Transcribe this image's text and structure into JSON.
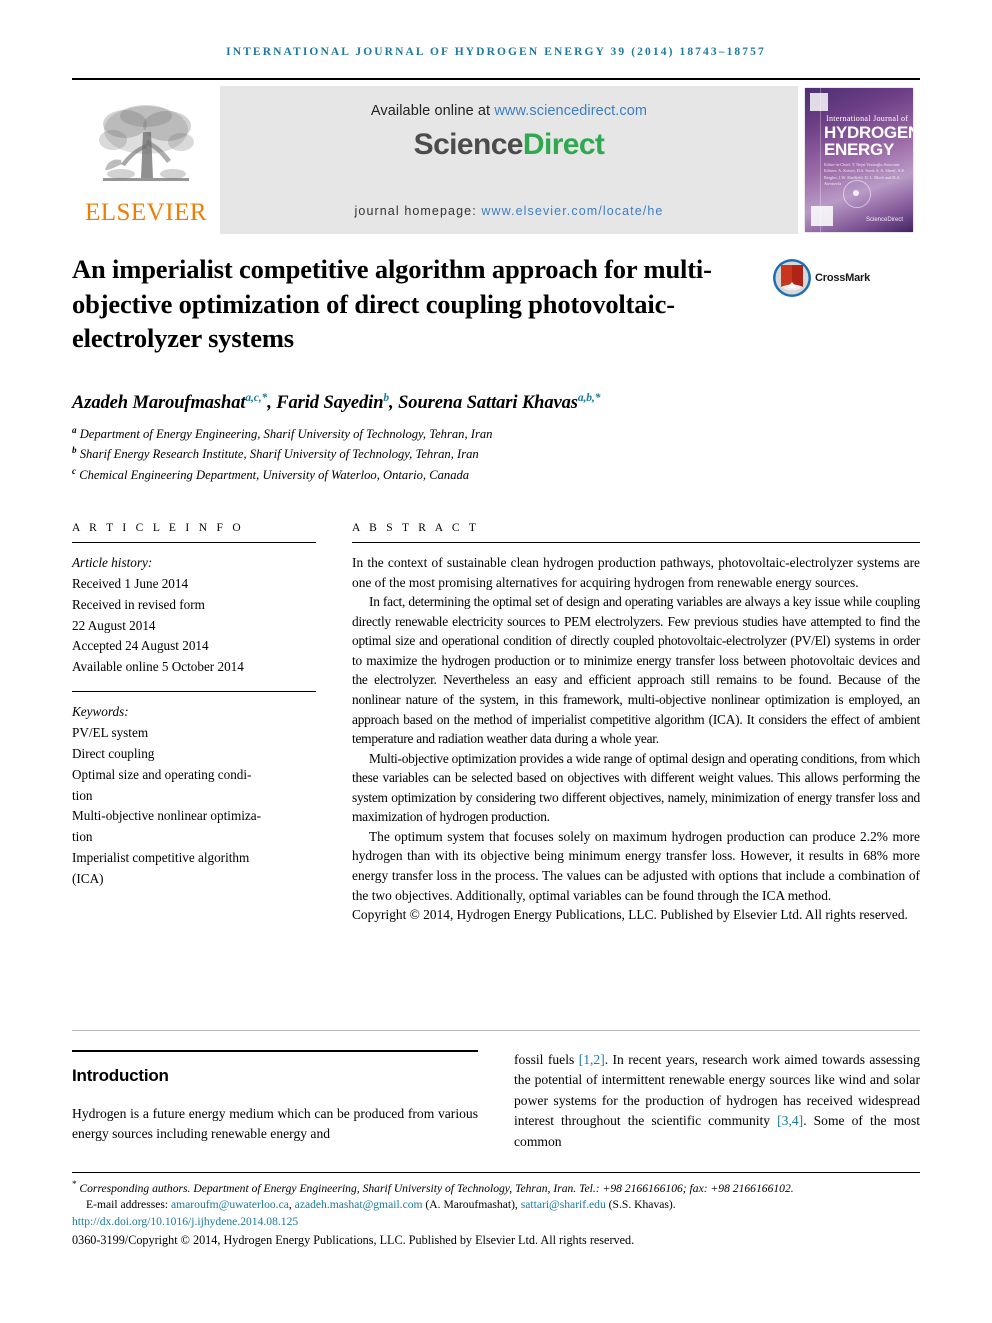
{
  "running_head": "International Journal of Hydrogen Energy 39 (2014) 18743–18757",
  "masthead": {
    "publisher_name": "ELSEVIER",
    "available_prefix": "Available online at ",
    "available_url": "www.sciencedirect.com",
    "sciencedirect_part1": "Science",
    "sciencedirect_part2": "Direct",
    "homepage_label": "journal homepage: ",
    "homepage_url": "www.elsevier.com/locate/he",
    "cover": {
      "line_small": "International Journal of",
      "line_big1": "HYDROGEN",
      "line_big2": "ENERGY",
      "editors": "Editor-in-Chief: T. Nejat Veziroğlu    Associate Editors: A. Kotsev, D.S. Scott, S. A. Sherif, A.E. Bergles, J.W. Sheffield, D. L. Block and D.A. Awotwefa",
      "sciencedirect_mark": "ScienceDirect"
    }
  },
  "title": "An imperialist competitive algorithm approach for multi-objective optimization of direct coupling photovoltaic-electrolyzer systems",
  "crossmark_label": "CrossMark",
  "authors": [
    {
      "name": "Azadeh Maroufmashat",
      "marks": "a,c,*"
    },
    {
      "name": "Farid Sayedin",
      "marks": "b"
    },
    {
      "name": "Sourena Sattari Khavas",
      "marks": "a,b,*"
    }
  ],
  "affiliations": [
    {
      "mark": "a",
      "text": "Department of Energy Engineering, Sharif University of Technology, Tehran, Iran"
    },
    {
      "mark": "b",
      "text": "Sharif Energy Research Institute, Sharif University of Technology, Tehran, Iran"
    },
    {
      "mark": "c",
      "text": "Chemical Engineering Department, University of Waterloo, Ontario, Canada"
    }
  ],
  "article_info": {
    "heading": "A R T I C L E   I N F O",
    "history_label": "Article history:",
    "history": [
      "Received 1 June 2014",
      "Received in revised form",
      "22 August 2014",
      "Accepted 24 August 2014",
      "Available online 5 October 2014"
    ],
    "keywords_label": "Keywords:",
    "keywords": [
      "PV/EL system",
      "Direct coupling",
      "Optimal size and operating condi-",
      "tion",
      "Multi-objective nonlinear optimiza-",
      "tion",
      "Imperialist competitive algorithm",
      "(ICA)"
    ]
  },
  "abstract": {
    "heading": "A B S T R A C T",
    "paragraphs": [
      "In the context of sustainable clean hydrogen production pathways, photovoltaic-electrolyzer systems are one of the most promising alternatives for acquiring hydrogen from renewable energy sources.",
      "In fact, determining the optimal set of design and operating variables are always a key issue while coupling directly renewable electricity sources to PEM electrolyzers. Few previous studies have attempted to find the optimal size and operational condition of directly coupled photovoltaic-electrolyzer (PV/El) systems in order to maximize the hydrogen production or to minimize energy transfer loss between photovoltaic devices and the electrolyzer. Nevertheless an easy and efficient approach still remains to be found. Because of the nonlinear nature of the system, in this framework, multi-objective nonlinear optimization is employed, an approach based on the method of imperialist competitive algorithm (ICA). It considers the effect of ambient temperature and radiation weather data during a whole year.",
      "Multi-objective optimization provides a wide range of optimal design and operating conditions, from which these variables can be selected based on objectives with different weight values. This allows performing the system optimization by considering two different objectives, namely, minimization of energy transfer loss and maximization of hydrogen production.",
      "The optimum system that focuses solely on maximum hydrogen production can produce 2.2% more hydrogen than with its objective being minimum energy transfer loss. However, it results in 68% more energy transfer loss in the process. The values can be adjusted with options that include a combination of the two objectives. Additionally, optimal variables can be found through the ICA method."
    ],
    "copyright": "Copyright © 2014, Hydrogen Energy Publications, LLC. Published by Elsevier Ltd. All rights reserved."
  },
  "body": {
    "intro_heading": "Introduction",
    "left_paragraph": "Hydrogen is a future energy medium which can be produced from various energy sources including renewable energy and",
    "right_paragraph_pre": "fossil fuels ",
    "right_cite_1": "[1,2]",
    "right_paragraph_mid": ". In recent years, research work aimed towards assessing the potential of intermittent renewable energy sources like wind and solar power systems for the production of hydrogen has received widespread interest throughout the scientific community ",
    "right_cite_2": "[3,4]",
    "right_paragraph_post": ". Some of the most common"
  },
  "footnotes": {
    "corresponding": "Corresponding authors. Department of Energy Engineering, Sharif University of Technology, Tehran, Iran. Tel.: +98 2166166106; fax: +98 2166166102.",
    "email_label": "E-mail addresses: ",
    "email_1": "amaroufm@uwaterloo.ca",
    "email_sep": ", ",
    "email_2": "azadeh.mashat@gmail.com",
    "email_1_owner": " (A. Maroufmashat), ",
    "email_3": "sattari@sharif.edu",
    "email_3_owner": " (S.S. Khavas).",
    "doi": "http://dx.doi.org/10.1016/j.ijhydene.2014.08.125",
    "issn": "0360-3199/Copyright © 2014, Hydrogen Energy Publications, LLC. Published by Elsevier Ltd. All rights reserved."
  },
  "colors": {
    "accent_teal": "#1b7a9e",
    "elsevier_orange": "#f07d00",
    "sciencedirect_green": "#2fa84f",
    "link_blue": "#3b7fc4"
  }
}
